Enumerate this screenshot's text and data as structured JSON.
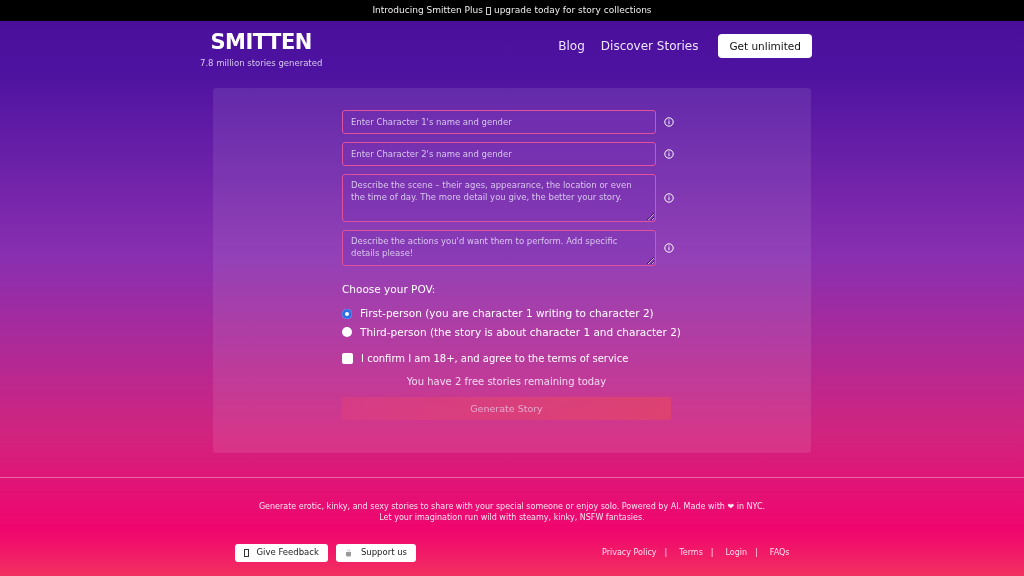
{
  "banner": {
    "text_before": "Introducing Smitten Plus",
    "text_after": "upgrade today for story collections"
  },
  "brand": {
    "logo": "SMITTEN",
    "tagline": "7.8 million stories generated"
  },
  "nav": {
    "links": [
      "Blog",
      "Discover Stories"
    ],
    "cta": "Get unlimited"
  },
  "form": {
    "fields": [
      {
        "kind": "input",
        "placeholder": "Enter Character 1's name and gender"
      },
      {
        "kind": "input",
        "placeholder": "Enter Character 2's name and gender"
      },
      {
        "kind": "textarea",
        "placeholder": "Describe the scene – their ages, appearance, the location or even the time of day. The more detail you give, the better your story."
      },
      {
        "kind": "textarea",
        "placeholder": "Describe the actions you'd want them to perform. Add specific details please!"
      }
    ],
    "pov_label": "Choose your POV:",
    "pov_options": [
      {
        "label": "First-person (you are character 1 writing to character 2)",
        "selected": true
      },
      {
        "label": "Third-person (the story is about character 1 and character 2)",
        "selected": false
      }
    ],
    "consent": {
      "label": "I confirm I am 18+, and agree to the terms of service",
      "checked": false
    },
    "remaining": "You have 2 free stories remaining today",
    "submit": {
      "label": "Generate Story",
      "disabled": true
    }
  },
  "footer": {
    "lines": [
      "Generate erotic, kinky, and sexy stories to share with your special someone or enjoy solo. Powered by AI. Made with ❤ in NYC.",
      "Let your imagination run wild with steamy, kinky, NSFW fantasies."
    ],
    "buttons": [
      {
        "kind": "feedback",
        "label": "Give Feedback"
      },
      {
        "kind": "support",
        "label": "Support us"
      }
    ],
    "links": [
      {
        "label": "Privacy Policy",
        "separator": "|"
      },
      {
        "label": "Terms",
        "separator": "|"
      },
      {
        "label": "Login",
        "separator": "|"
      },
      {
        "label": "FAQs"
      }
    ]
  }
}
